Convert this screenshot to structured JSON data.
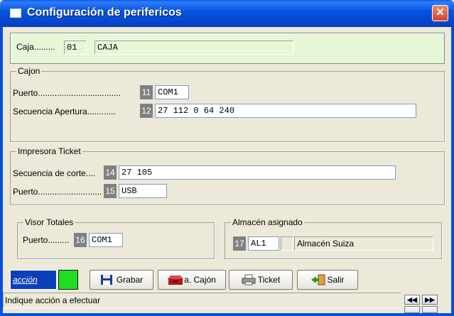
{
  "window": {
    "title": "Configuración de perifericos",
    "close_label": "✕"
  },
  "caja": {
    "label": "Caja.........",
    "code": "01",
    "name": "CAJA"
  },
  "cajon": {
    "legend": "Cajon",
    "puerto_label": "Puerto...................................",
    "puerto_num": "11",
    "puerto_value": "COM1",
    "secuencia_label": "Secuencia Apertura............",
    "secuencia_num": "12",
    "secuencia_value": "27 112 0 64 240"
  },
  "impresora": {
    "legend": "Impresora Ticket",
    "corte_label": "Secuencia de corte....",
    "corte_num": "14",
    "corte_value": "27 105",
    "puerto_label": "Puerto...........................",
    "puerto_num": "15",
    "puerto_value": "USB"
  },
  "visor": {
    "legend": "Visor Totales",
    "puerto_label": "Puerto.........",
    "puerto_num": "16",
    "puerto_value": "COM1"
  },
  "almacen": {
    "legend": "Almacén asignado",
    "num": "17",
    "code": "AL1",
    "name": "Almacén Suiza"
  },
  "toolbar": {
    "accion_label": "acción",
    "grabar_label": "Grabar",
    "cajon_label": "a. Cajón",
    "ticket_label": "Ticket",
    "salir_label": "Salir"
  },
  "status": {
    "message": "Indique acción a efectuar"
  },
  "colors": {
    "title_blue": "#0854e0",
    "caja_bg": "#e6f7d8",
    "status_green": "#22dd22",
    "close_red": "#d4452a"
  }
}
